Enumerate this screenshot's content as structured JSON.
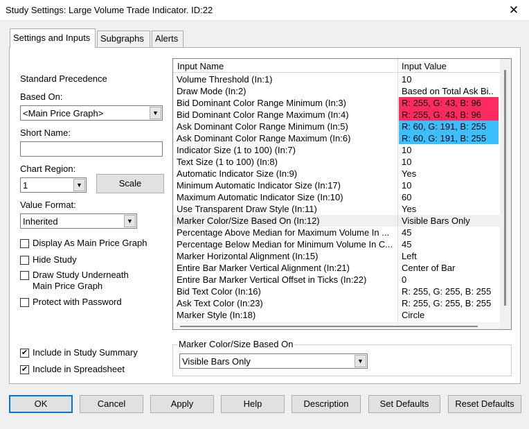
{
  "window": {
    "title": "Study Settings: Large Volume Trade Indicator. ID:22",
    "close_glyph": "✕"
  },
  "tabs": [
    {
      "label": "Settings and Inputs",
      "active": true
    },
    {
      "label": "Subgraphs",
      "active": false
    },
    {
      "label": "Alerts",
      "active": false
    }
  ],
  "left": {
    "standard_precedence": "Standard Precedence",
    "based_on_label": "Based On:",
    "based_on_value": "<Main Price Graph>",
    "short_name_label": "Short Name:",
    "short_name_value": "",
    "chart_region_label": "Chart Region:",
    "chart_region_value": "1",
    "scale_button": "Scale",
    "value_format_label": "Value Format:",
    "value_format_value": "Inherited",
    "checks": [
      {
        "label": "Display As Main Price Graph",
        "checked": false
      },
      {
        "label": "Hide Study",
        "checked": false
      },
      {
        "label": "Draw Study Underneath",
        "label2": "Main Price Graph",
        "checked": false
      },
      {
        "label": "Protect with Password",
        "checked": false
      }
    ],
    "bottom_checks": [
      {
        "label": "Include in Study Summary",
        "checked": true
      },
      {
        "label": "Include in Spreadsheet",
        "checked": true
      }
    ]
  },
  "grid": {
    "col_name": "Input Name",
    "col_value": "Input Value",
    "rows": [
      {
        "name": "Volume Threshold  (In:1)",
        "value": "10",
        "bg": ""
      },
      {
        "name": "Draw Mode  (In:2)",
        "value": "Based on Total Ask Bi..",
        "bg": ""
      },
      {
        "name": "Bid Dominant Color Range Minimum  (In:3)",
        "value": "R: 255, G: 43, B: 96",
        "bg": "#ff2b60"
      },
      {
        "name": "Bid Dominant Color Range Maximum  (In:4)",
        "value": "R: 255, G: 43, B: 96",
        "bg": "#ff2b60"
      },
      {
        "name": "Ask Dominant Color Range Minimum  (In:5)",
        "value": "R: 60, G: 191, B: 255",
        "bg": "#3cbfff"
      },
      {
        "name": "Ask Dominant Color Range Maximum  (In:6)",
        "value": "R: 60, G: 191, B: 255",
        "bg": "#3cbfff"
      },
      {
        "name": "Indicator Size (1 to 100)  (In:7)",
        "value": "10",
        "bg": ""
      },
      {
        "name": "Text Size (1 to 100)  (In:8)",
        "value": "10",
        "bg": ""
      },
      {
        "name": "Automatic Indicator Size  (In:9)",
        "value": "Yes",
        "bg": ""
      },
      {
        "name": "Minimum Automatic Indicator Size  (In:17)",
        "value": "10",
        "bg": ""
      },
      {
        "name": "Maximum Automatic Indicator Size  (In:10)",
        "value": "60",
        "bg": ""
      },
      {
        "name": "Use Transparent Draw Style  (In:11)",
        "value": "Yes",
        "bg": ""
      },
      {
        "name": "Marker Color/Size Based On  (In:12)",
        "value": "Visible Bars Only",
        "bg": "",
        "selected": true
      },
      {
        "name": "Percentage Above Median for Maximum Volume In ...",
        "value": "45",
        "bg": ""
      },
      {
        "name": "Percentage Below Median for Minimum Volume In C...",
        "value": "45",
        "bg": ""
      },
      {
        "name": "Marker Horizontal Alignment  (In:15)",
        "value": "Left",
        "bg": ""
      },
      {
        "name": "Entire Bar Marker Vertical Alignment  (In:21)",
        "value": "Center of Bar",
        "bg": ""
      },
      {
        "name": "Entire Bar Marker Vertical Offset in Ticks  (In:22)",
        "value": "0",
        "bg": ""
      },
      {
        "name": "Bid Text Color  (In:16)",
        "value": "R: 255, G: 255, B: 255",
        "bg": ""
      },
      {
        "name": "Ask Text Color  (In:23)",
        "value": "R: 255, G: 255, B: 255",
        "bg": ""
      },
      {
        "name": "Marker Style  (In:18)",
        "value": "Circle",
        "bg": ""
      }
    ]
  },
  "editor": {
    "legend": "Marker Color/Size Based On",
    "value": "Visible Bars Only"
  },
  "buttons": {
    "ok": "OK",
    "cancel": "Cancel",
    "apply": "Apply",
    "help": "Help",
    "description": "Description",
    "set_defaults": "Set Defaults",
    "reset_defaults": "Reset Defaults"
  },
  "colors": {
    "bid_color": "#ff2b60",
    "ask_color": "#3cbfff",
    "selected_row": "#f0f0f0",
    "default_button_border": "#0078d7"
  }
}
